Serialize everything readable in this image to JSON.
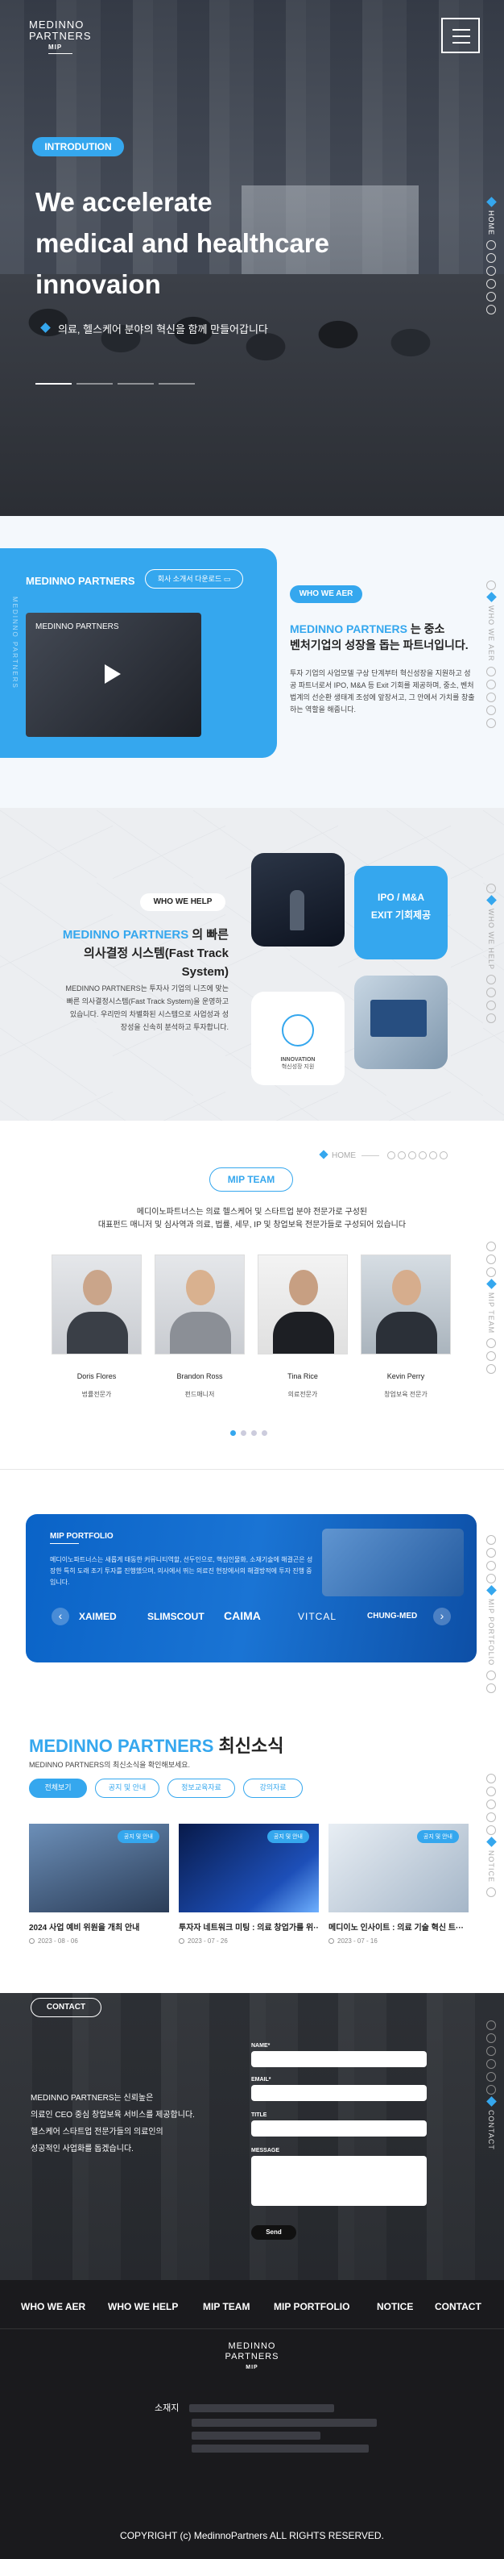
{
  "brand": {
    "logo_line1": "MEDINNO",
    "logo_line2": "PARTNERS",
    "logo_badge": "MIP"
  },
  "hero": {
    "tag": "INTRODUTION",
    "title_line1": "We accelerate",
    "title_line2": "medical and healthcare",
    "title_line3": "innovaion",
    "subtitle": "의료, 헬스케어 분야의 혁신을 함께 만들어갑니다"
  },
  "side_nav": {
    "home": "HOME",
    "who_we_aer": "WHO WE AER",
    "who_we_help": "WHO WE HELP",
    "mip_team": "MIP TEAM",
    "mip_portfolio": "MIP PORTFOLIO",
    "notice": "NOTICE",
    "contact": "CONTACT"
  },
  "who_we_aer": {
    "card_title": "MEDINNO PARTNERS",
    "card_button": "회사 소개서 다운로드",
    "video_caption": "MEDINNO PARTNERS",
    "tag": "WHO WE AER",
    "headline_brand": "MEDINNO PARTNERS",
    "headline_rest1": " 는 중소",
    "headline_line2": "벤처기업의 성장을 돕는 파트너입니다.",
    "body": "투자 기업의 사업모델 구상 단계부터 혁신성장을 지원하고 성공 파트너로서 IPO, M&A 등 Exit 기회를 제공하며, 중소, 벤처법계의 선순환 생태계 조성에 앞장서고, 그 안에서 가치를 창출하는 역할을 해줍니다."
  },
  "who_we_help": {
    "tag": "WHO WE HELP",
    "headline_brand": "MEDINNO PARTNERS",
    "headline_rest1": " 의 빠른",
    "headline_line2": "의사결정 시스템(Fast Track System)",
    "body": "MEDINNO PARTNERS는 투자사 기업의 니즈에 맞는 빠른 의사결정시스템(Fast Track System)을 운영하고 있습니다. 우리만의 차별화된 시스템으로 사업성과 성장성을 신속히 분석하고 투자합니다.",
    "tile_text_line1": "IPO / M&A",
    "tile_text_line2": "EXIT 기회제공",
    "innovation_label": "INNOVATION",
    "innovation_sub": "혁신성장 지원"
  },
  "mip_team": {
    "home_label": "HOME",
    "tag": "MIP TEAM",
    "desc_line1": "메디이노파트너스는 의료 헬스케어 및 스타트업 분야 전문가로 구성된",
    "desc_line2": "대표펀드 매니저 및 심사역과 의료, 법률, 세무, IP 및 창업보육 전문가들로 구성되어 있습니다",
    "members": [
      {
        "name": "Doris Flores",
        "role": "법률전문가"
      },
      {
        "name": "Brandon Ross",
        "role": "펀드매니저"
      },
      {
        "name": "Tina Rice",
        "role": "의료전문가"
      },
      {
        "name": "Kevin Perry",
        "role": "창업보육 전문가"
      }
    ]
  },
  "mip_portfolio": {
    "title": "MIP PORTFOLIO",
    "desc": "메디이노파트너스는 새롭게 태동한 커뮤니티역할, 선두인으로, 핵심인물화, 소재기술에 해결곤은 성장한 특히 도래 조기 투자를 진행했으며, 의사에서 뛰는 의료진 현장에서의 해결방적에 투자 진행 중 입니다.",
    "prev": "‹",
    "next": "›",
    "logos": [
      "XAIMED",
      "SLIMSCOUT",
      "CAIMA",
      "VITCAL",
      "CHUNG-MED"
    ]
  },
  "news": {
    "title_brand": "MEDINNO PARTNERS",
    "title_rest": " 최신소식",
    "subtitle": "MEDINNO PARTNERS의 최신소식을 확인해보세요.",
    "tabs": [
      "전체보기",
      "공지 및 안내",
      "정보교육자료",
      "강의자료"
    ],
    "cards": [
      {
        "badge": "공지 및 안내",
        "title": "2024 사업 예비 위원을 개최 안내",
        "date": "2023 - 08 - 06"
      },
      {
        "badge": "공지 및 안내",
        "title": "투자자 네트워크 미팅 : 의료 창업가를 위···",
        "date": "2023 - 07 - 26"
      },
      {
        "badge": "공지 및 안내",
        "title": "메디이노 인사이트 : 의료 기술 혁신 트···",
        "date": "2023 - 07 - 16"
      }
    ]
  },
  "contact": {
    "tag": "CONTACT",
    "body_line1": "MEDINNO PARTNERS는 신뢰높은",
    "body_line2": "의료인 CEO 중심 창업보육 서비스를 제공합니다.",
    "body_line3": "헬스케어 스타트업 전문가들의 의료인의",
    "body_line4": "성공적인 사업화를 돕겠습니다.",
    "name_label": "NAME*",
    "email_label": "EMAIL*",
    "title_label": "TITLE",
    "message_label": "MESSAGE",
    "send": "Send"
  },
  "footer": {
    "nav": [
      "WHO WE AER",
      "WHO WE HELP",
      "MIP TEAM",
      "MIP PORTFOLIO",
      "NOTICE",
      "CONTACT"
    ],
    "address_label": "소재지",
    "copyright": "COPYRIGHT (c) MedinnoPartners ALL RIGHTS RESERVED."
  },
  "colors": {
    "accent": "#35a7ee",
    "dark": "#1a1a1d",
    "portfolio": "#0a63c7"
  }
}
